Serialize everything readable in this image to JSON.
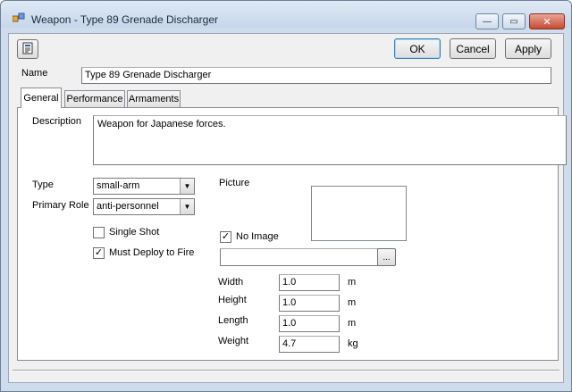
{
  "window": {
    "title": "Weapon - Type 89 Grenade Discharger",
    "min_glyph": "—",
    "max_glyph": "▭",
    "close_glyph": "✕"
  },
  "toolbar": {
    "ok_label": "OK",
    "cancel_label": "Cancel",
    "apply_label": "Apply"
  },
  "name": {
    "label": "Name",
    "value": "Type 89 Grenade Discharger"
  },
  "tabs": [
    {
      "label": "General",
      "active": true
    },
    {
      "label": "Performance",
      "active": false
    },
    {
      "label": "Armaments",
      "active": false
    }
  ],
  "general": {
    "description_label": "Description",
    "description_value": "Weapon for Japanese forces.",
    "type_label": "Type",
    "type_value": "small-arm",
    "primary_role_label": "Primary Role",
    "primary_role_value": "anti-personnel",
    "single_shot_label": "Single Shot",
    "single_shot_checked": false,
    "must_deploy_label": "Must Deploy to Fire",
    "must_deploy_checked": true,
    "picture_label": "Picture",
    "no_image_label": "No Image",
    "no_image_checked": true,
    "picture_path_value": "",
    "browse_label": "...",
    "dimensions": [
      {
        "label": "Width",
        "value": "1.0",
        "unit": "m"
      },
      {
        "label": "Height",
        "value": "1.0",
        "unit": "m"
      },
      {
        "label": "Length",
        "value": "1.0",
        "unit": "m"
      },
      {
        "label": "Weight",
        "value": "4.7",
        "unit": "kg"
      }
    ]
  },
  "check_glyph": "✓",
  "dropdown_glyph": "▼"
}
